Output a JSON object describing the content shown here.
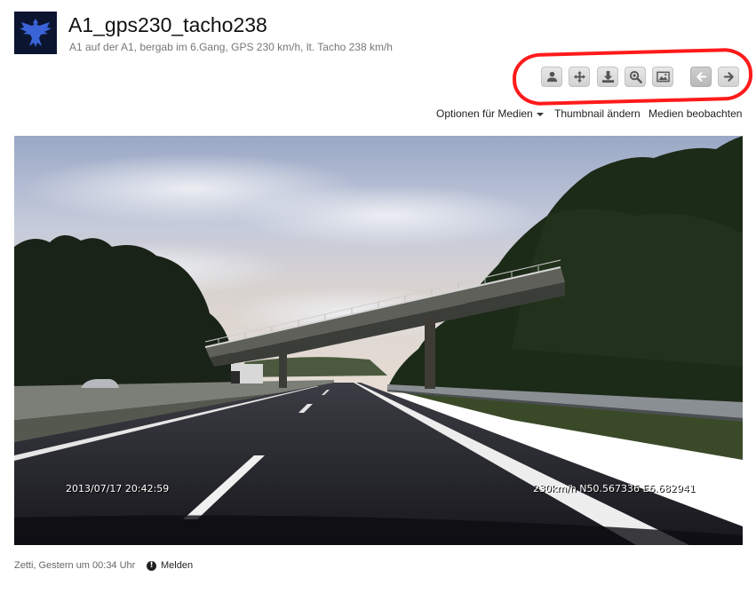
{
  "media": {
    "title": "A1_gps230_tacho238",
    "description": "A1 auf der A1, bergab im 6.Gang, GPS 230 km/h, lt. Tacho 238 km/h"
  },
  "toolbar": {
    "buttons": [
      {
        "icon": "user-icon"
      },
      {
        "icon": "move-icon"
      },
      {
        "icon": "download-icon"
      },
      {
        "icon": "zoom-in-icon"
      },
      {
        "icon": "image-icon"
      },
      {
        "icon": "arrow-left-icon"
      },
      {
        "icon": "arrow-right-icon"
      }
    ]
  },
  "options": {
    "media_options_label": "Optionen für Medien",
    "thumbnail_label": "Thumbnail ändern",
    "watch_label": "Medien beobachten"
  },
  "dashcam": {
    "timestamp": "2013/07/17 20:42:59",
    "gps_readout": "230km/h N50.567336 E6.682941"
  },
  "footer": {
    "author_time": "Zetti, Gestern um 00:34 Uhr",
    "report_label": "Melden"
  },
  "colors": {
    "annotation": "#ff1a1a",
    "avatar_bg": "#0b1530",
    "avatar_logo": "#3a63d8"
  }
}
